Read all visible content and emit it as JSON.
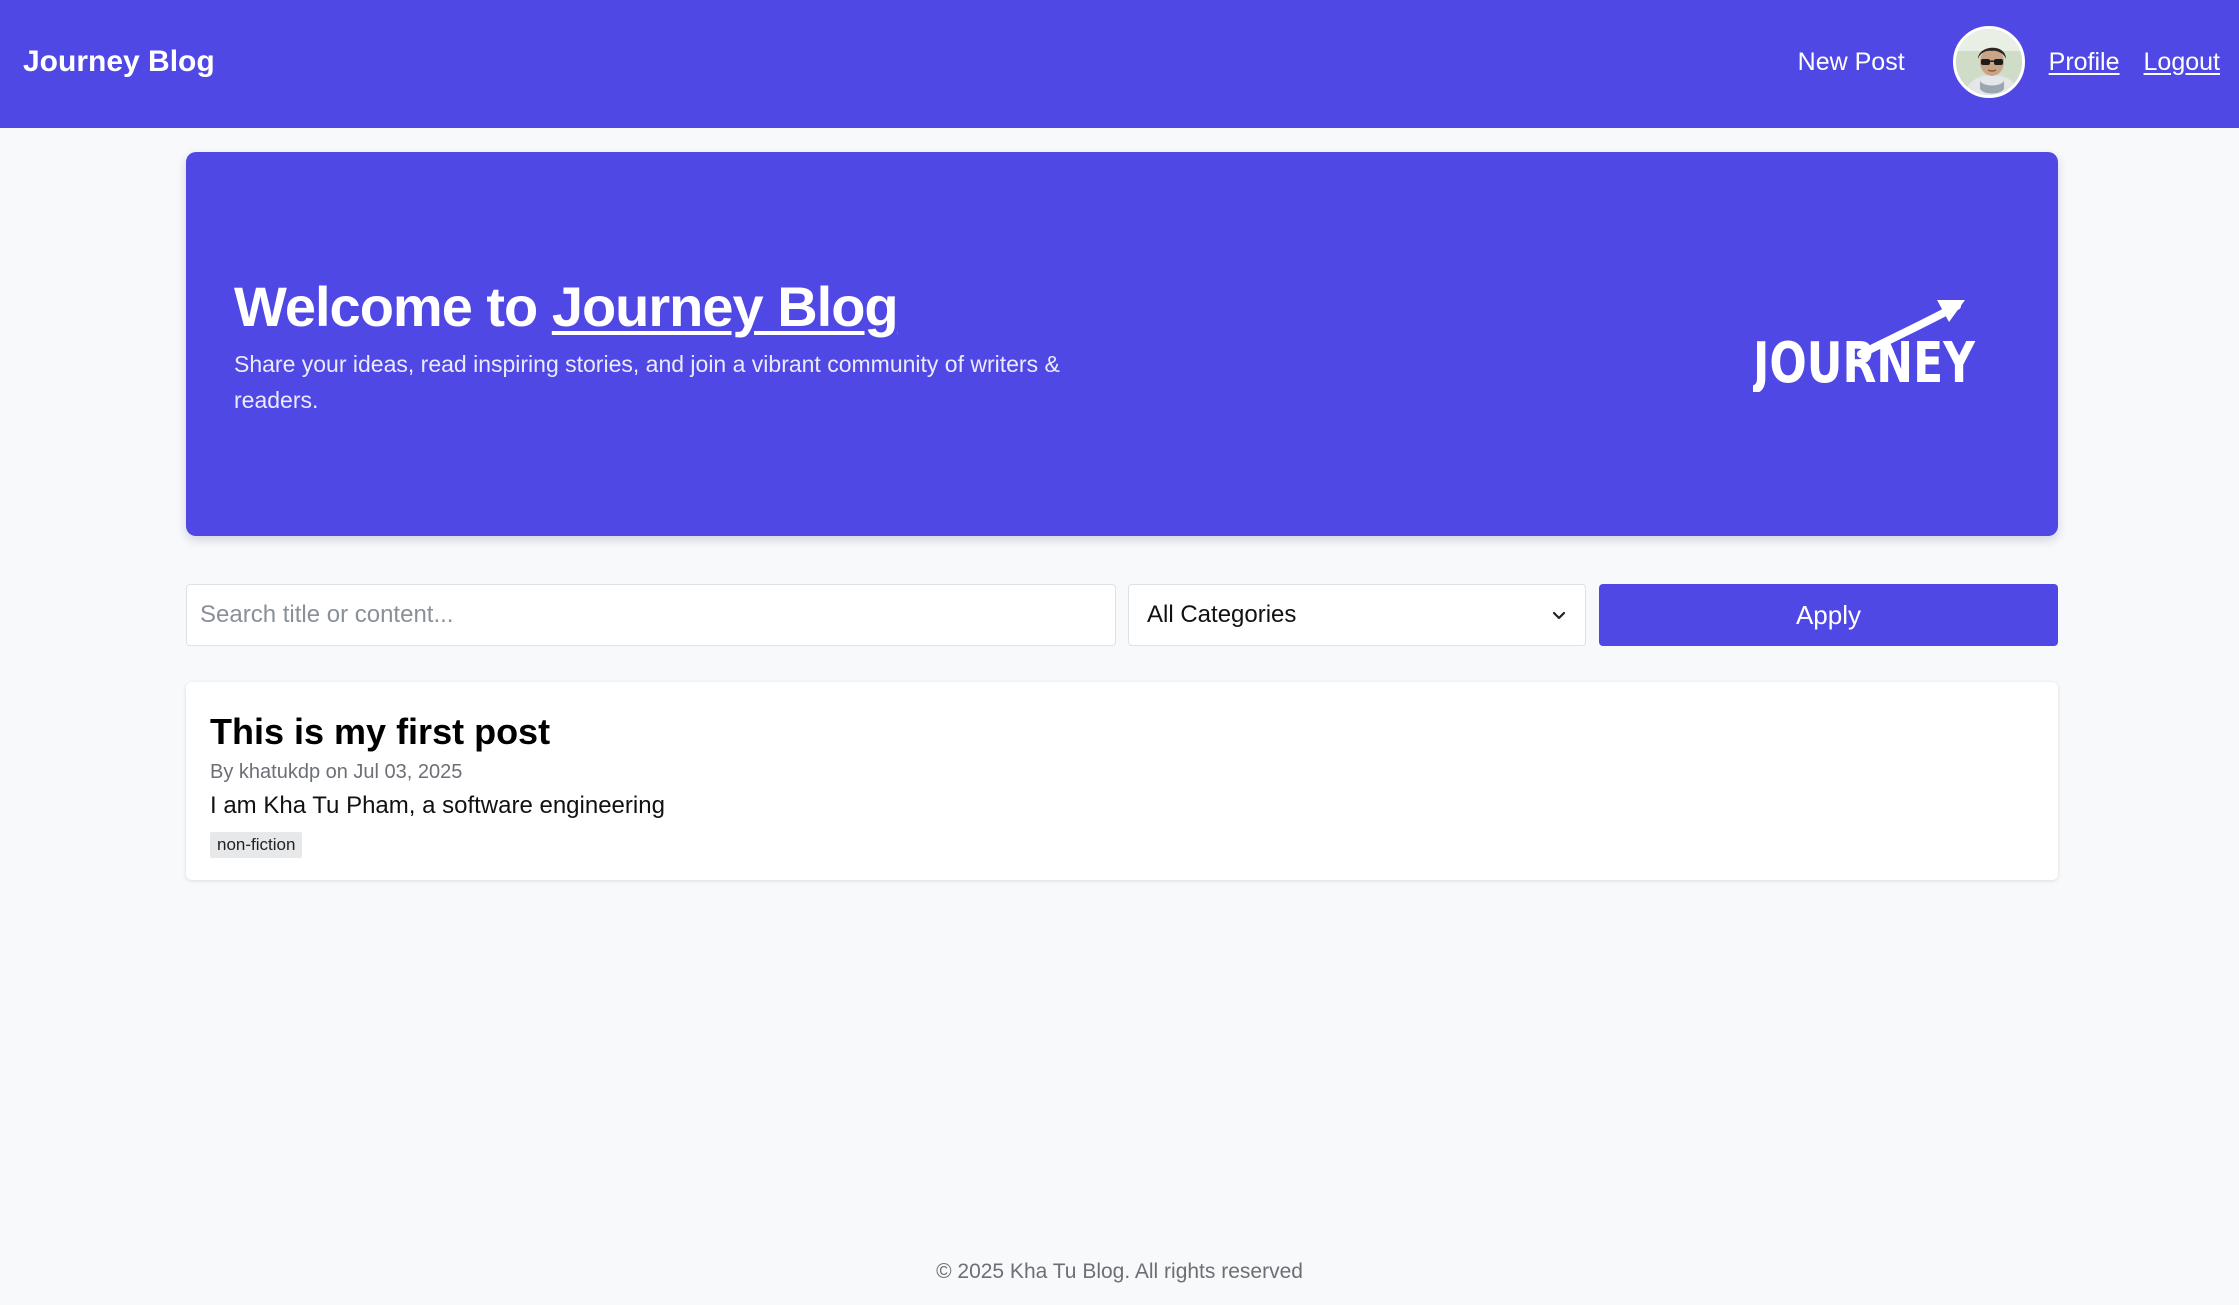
{
  "navbar": {
    "brand": "Journey Blog",
    "new_post": "New Post",
    "profile": "Profile",
    "logout": "Logout"
  },
  "hero": {
    "title_prefix": "Welcome to ",
    "title_link": "Journey Blog",
    "subtitle": "Share your ideas, read inspiring stories, and join a vibrant community of writers & readers.",
    "logo_text": "JOURNEY"
  },
  "filters": {
    "search_placeholder": "Search title or content...",
    "search_value": "",
    "category_selected": "All Categories",
    "apply_label": "Apply"
  },
  "posts": [
    {
      "title": "This is my first post",
      "meta": "By khatukdp on Jul 03, 2025",
      "excerpt": "I am Kha Tu Pham, a software engineering",
      "tag": "non-fiction"
    }
  ],
  "footer": {
    "text": "© 2025 Kha Tu Blog. All rights reserved"
  },
  "colors": {
    "brand_primary": "#5048e5",
    "page_background": "#f8f9fb",
    "card_background": "#ffffff",
    "muted_text": "#6c6f75",
    "tag_background": "#e7e8ea"
  },
  "icons": {
    "avatar": "user-avatar-photo",
    "select_chevron": "chevron-down-icon",
    "logo_arrow": "arrow-up-right-icon"
  }
}
